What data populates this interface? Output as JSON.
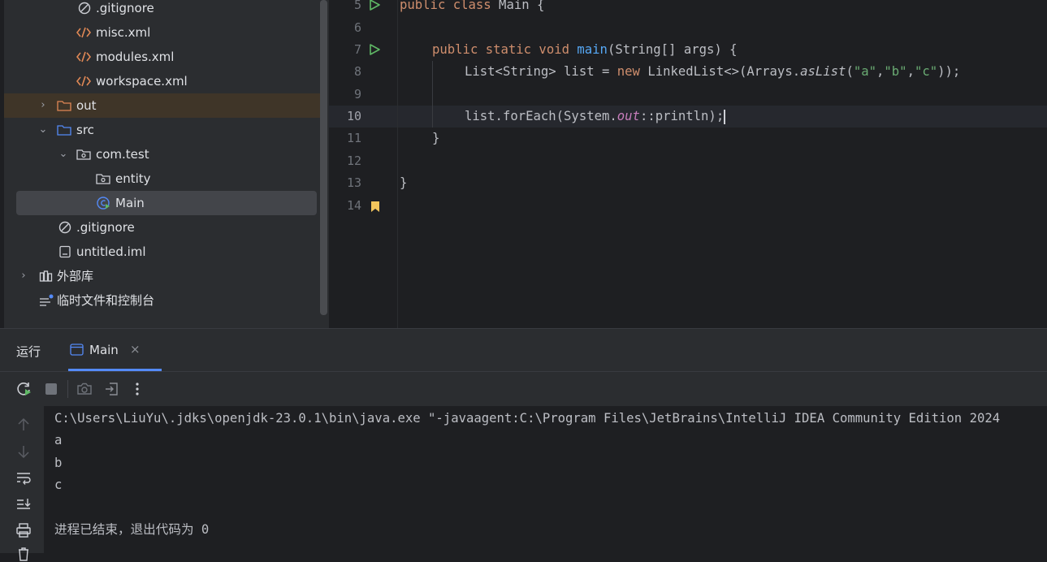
{
  "project_tree": {
    "items": [
      {
        "label": ".gitignore",
        "icon": "ignore-icon"
      },
      {
        "label": "misc.xml",
        "icon": "xml-icon"
      },
      {
        "label": "modules.xml",
        "icon": "xml-icon"
      },
      {
        "label": "workspace.xml",
        "icon": "xml-icon"
      },
      {
        "label": "out",
        "icon": "folder-icon",
        "arrow": "›"
      },
      {
        "label": "src",
        "icon": "folder-icon",
        "arrow": "⌄"
      },
      {
        "label": "com.test",
        "icon": "package-icon",
        "arrow": "⌄"
      },
      {
        "label": "entity",
        "icon": "package-icon"
      },
      {
        "label": "Main",
        "icon": "class-icon"
      },
      {
        "label": ".gitignore",
        "icon": "ignore-icon"
      },
      {
        "label": "untitled.iml",
        "icon": "iml-icon"
      },
      {
        "label": "外部库",
        "icon": "library-icon",
        "arrow": "›"
      },
      {
        "label": "临时文件和控制台",
        "icon": "scratches-icon"
      }
    ]
  },
  "editor": {
    "line_numbers": [
      "5",
      "6",
      "7",
      "8",
      "9",
      "10",
      "11",
      "12",
      "13",
      "14"
    ],
    "current_line": "10",
    "code": {
      "l5_kw": "public class",
      "l5_rest": " Main {",
      "l7_kw1": "public static void",
      "l7_fn": "main",
      "l7_rest": "(String[] args) {",
      "l8_a": "List<String> list = ",
      "l8_kw": "new",
      "l8_b": " LinkedList<>(Arrays.",
      "l8_im": "asList",
      "l8_s1": "\"a\"",
      "l8_s2": "\"b\"",
      "l8_s3": "\"c\"",
      "l8_end": "));",
      "l10_a": "list.forEach(System.",
      "l10_it": "out",
      "l10_b": "::println);",
      "l11": "}",
      "l13": "}"
    }
  },
  "run_panel": {
    "title": "运行",
    "tab_label": "Main",
    "tab_close": "×",
    "console_lines": [
      "C:\\Users\\LiuYu\\.jdks\\openjdk-23.0.1\\bin\\java.exe \"-javaagent:C:\\Program Files\\JetBrains\\IntelliJ IDEA Community Edition 2024",
      "a",
      "b",
      "c",
      "",
      "进程已结束，退出代码为 0"
    ]
  },
  "colors": {
    "accent": "#548af7",
    "keyword": "#cf8e6d",
    "function": "#56a8f5",
    "string": "#6aab73",
    "static_field": "#c77dbb",
    "run_green": "#5fb865"
  }
}
